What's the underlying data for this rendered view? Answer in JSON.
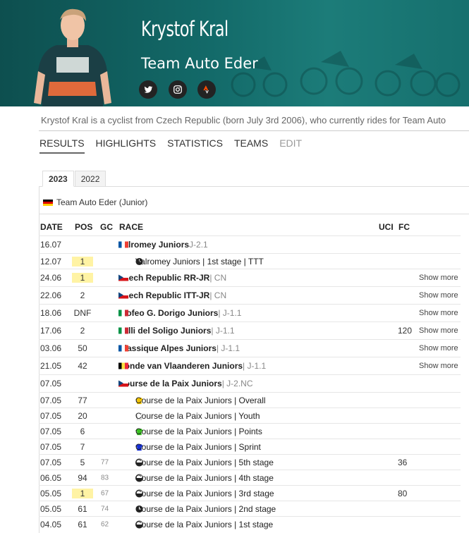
{
  "header": {
    "name": "Krystof Kral",
    "team": "Team Auto Eder",
    "socials": [
      "twitter-icon",
      "instagram-icon",
      "strava-icon"
    ]
  },
  "bio": "Krystof Kral is a cyclist from Czech Republic (born July 3rd 2006), who currently rides for Team Auto",
  "tabs": [
    {
      "label": "RESULTS",
      "active": true
    },
    {
      "label": "HIGHLIGHTS"
    },
    {
      "label": "STATISTICS"
    },
    {
      "label": "TEAMS"
    },
    {
      "label": "EDIT",
      "disabled": true
    }
  ],
  "years": [
    "2023",
    "2022"
  ],
  "team_line": "Team Auto Eder (Junior)",
  "columns": {
    "date": "DATE",
    "pos": "POS",
    "gc": "GC",
    "race": "RACE",
    "uci": "UCI",
    "fc": "FC"
  },
  "rows": [
    {
      "date": "16.07",
      "pos": "",
      "gc": "",
      "flag": "fr",
      "race": "Valromey Juniors",
      "cls": "J-2.1",
      "sep": " ",
      "main": true,
      "uci": "",
      "more": ""
    },
    {
      "date": "12.07",
      "pos": "1",
      "gc": "",
      "icon": "ttt",
      "race": "Valromey Juniors | 1st stage | TTT",
      "sub": true,
      "uci": "",
      "more": ""
    },
    {
      "date": "24.06",
      "pos": "1",
      "gc": "",
      "flag": "cz",
      "race": "Czech Republic RR-JR",
      "cls": "| CN",
      "main": true,
      "uci": "",
      "more": "Show more"
    },
    {
      "date": "22.06",
      "pos": "2",
      "gc": "",
      "flag": "cz",
      "race": "Czech Republic ITT-JR",
      "cls": "| CN",
      "main": true,
      "uci": "",
      "more": "Show more"
    },
    {
      "date": "18.06",
      "pos": "DNF",
      "gc": "",
      "flag": "it",
      "race": "Trofeo G. Dorigo Juniors",
      "cls": "| J-1.1",
      "main": true,
      "uci": "",
      "more": "Show more"
    },
    {
      "date": "17.06",
      "pos": "2",
      "gc": "",
      "flag": "it",
      "race": "Valli del Soligo Juniors",
      "cls": "| J-1.1",
      "main": true,
      "uci": "120",
      "more": "Show more"
    },
    {
      "date": "03.06",
      "pos": "50",
      "gc": "",
      "flag": "fr",
      "race": "Classique Alpes Juniors",
      "cls": "| J-1.1",
      "main": true,
      "uci": "",
      "more": "Show more"
    },
    {
      "date": "21.05",
      "pos": "42",
      "gc": "",
      "flag": "be",
      "race": "Ronde van Vlaanderen Juniors",
      "cls": "| J-1.1",
      "main": true,
      "uci": "",
      "more": "Show more"
    },
    {
      "date": "07.05",
      "pos": "",
      "gc": "",
      "flag": "cz",
      "race": "Course de la Paix Juniors",
      "cls": "| J-2.NC",
      "main": true,
      "uci": "",
      "more": ""
    },
    {
      "date": "07.05",
      "pos": "77",
      "gc": "",
      "icon": "jersey-yellow",
      "race": "Course de la Paix Juniors | Overall",
      "sub": true,
      "uci": "",
      "more": ""
    },
    {
      "date": "07.05",
      "pos": "20",
      "gc": "",
      "icon": "jersey-white",
      "race": "Course de la Paix Juniors | Youth",
      "sub": true,
      "uci": "",
      "more": ""
    },
    {
      "date": "07.05",
      "pos": "6",
      "gc": "",
      "icon": "jersey-green",
      "race": "Course de la Paix Juniors | Points",
      "sub": true,
      "uci": "",
      "more": ""
    },
    {
      "date": "07.05",
      "pos": "7",
      "gc": "",
      "icon": "jersey-blue",
      "race": "Course de la Paix Juniors | Sprint",
      "sub": true,
      "uci": "",
      "more": ""
    },
    {
      "date": "07.05",
      "pos": "5",
      "gc": "77",
      "icon": "hilly",
      "race": "Course de la Paix Juniors | 5th stage",
      "sub": true,
      "uci": "36",
      "more": ""
    },
    {
      "date": "06.05",
      "pos": "94",
      "gc": "83",
      "icon": "hilly",
      "race": "Course de la Paix Juniors | 4th stage",
      "sub": true,
      "uci": "",
      "more": ""
    },
    {
      "date": "05.05",
      "pos": "1",
      "gc": "67",
      "icon": "hilly",
      "race": "Course de la Paix Juniors | 3rd stage",
      "sub": true,
      "uci": "80",
      "more": ""
    },
    {
      "date": "05.05",
      "pos": "61",
      "gc": "74",
      "icon": "ttt",
      "race": "Course de la Paix Juniors | 2nd stage",
      "sub": true,
      "uci": "",
      "more": ""
    },
    {
      "date": "04.05",
      "pos": "61",
      "gc": "62",
      "icon": "hilly",
      "race": "Course de la Paix Juniors | 1st stage",
      "sub": true,
      "uci": "",
      "more": ""
    }
  ]
}
